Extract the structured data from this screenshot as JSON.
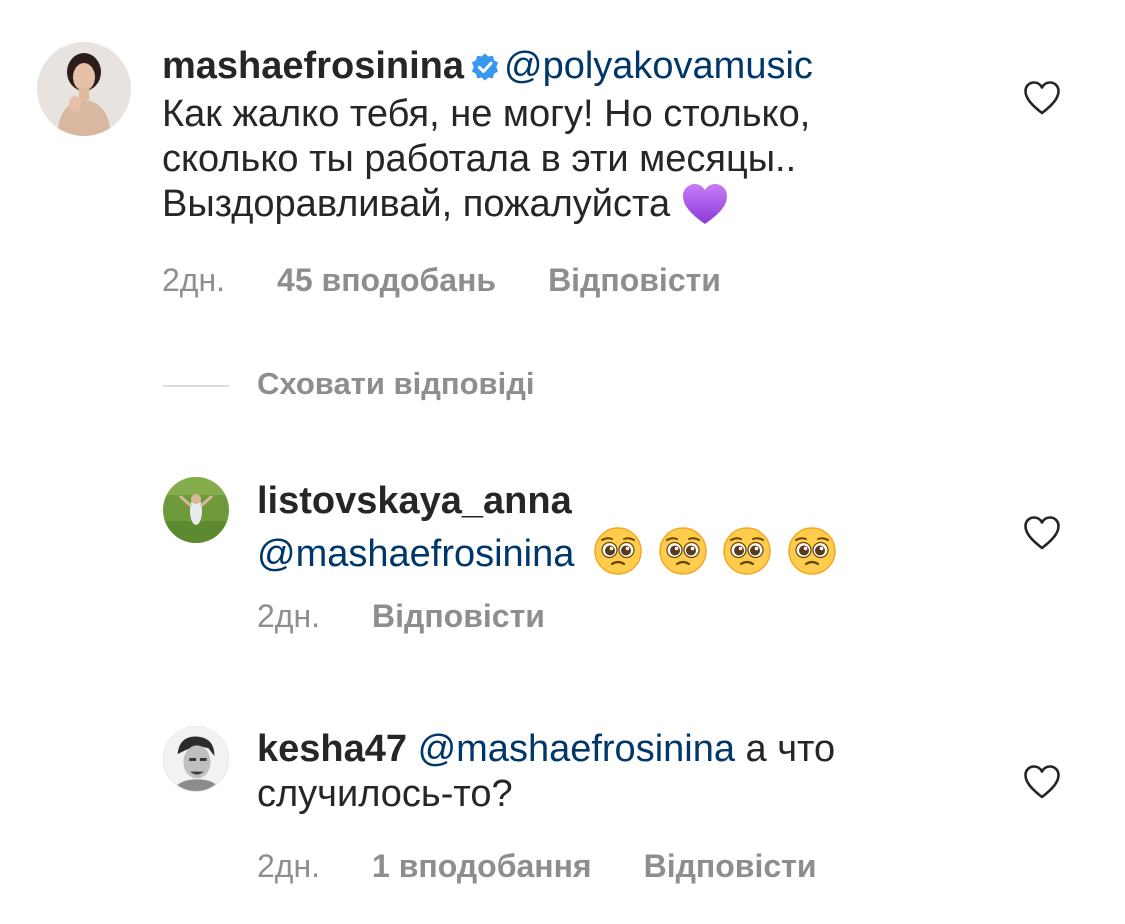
{
  "comment1": {
    "username": "mashaefrosinina",
    "mention": "@polyakovamusic",
    "lines": [
      "Как жалко тебя, не могу! Но столько,",
      "сколько ты работала в эти месяцы..",
      "Выздоравливай, пожалуйста"
    ],
    "emoji": "purple-heart-icon",
    "time": "2дн.",
    "likes": "45 вподобань",
    "reply": "Відповісти"
  },
  "hide_replies": "Сховати відповіді",
  "reply1": {
    "username": "listovskaya_anna",
    "mention": "@mashaefrosinina",
    "emojis": [
      "pleading-face-icon",
      "pleading-face-icon",
      "pleading-face-icon",
      "pleading-face-icon"
    ],
    "time": "2дн.",
    "reply": "Відповісти"
  },
  "reply2": {
    "username": "kesha47",
    "mention": "@mashaefrosinina",
    "text_tail": "а что",
    "text_line2": "случилось-то?",
    "time": "2дн.",
    "likes": "1 вподобання",
    "reply": "Відповісти"
  },
  "colors": {
    "text": "#262626",
    "mention": "#00376b",
    "meta": "#8e8e8e",
    "verified": "#3897f0",
    "divider": "#dbdbdb"
  }
}
